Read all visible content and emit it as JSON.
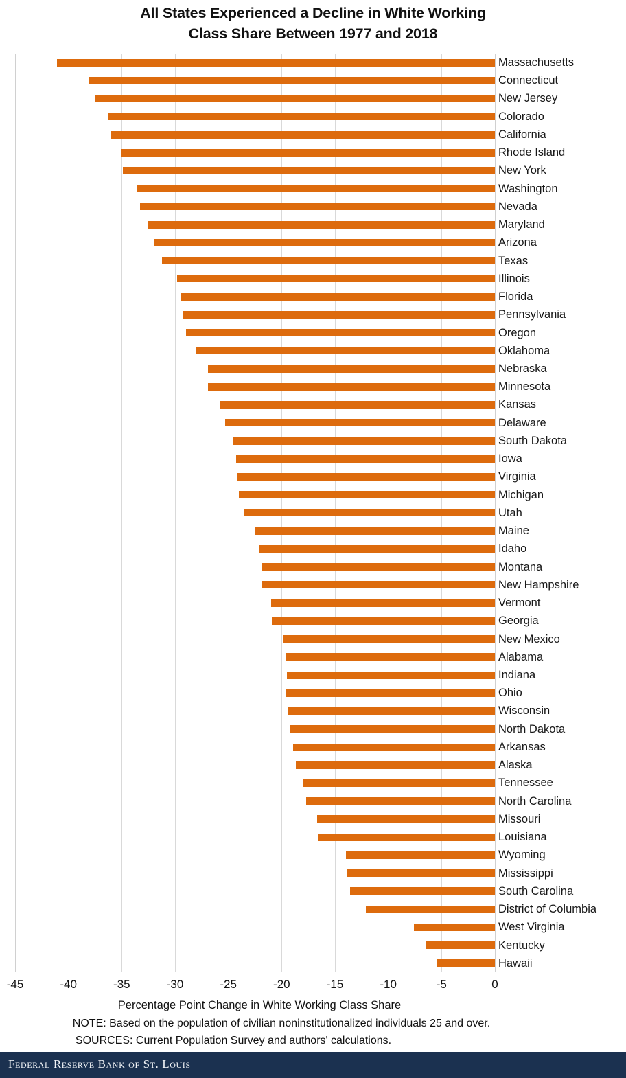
{
  "title": {
    "line1": "All States Experienced a Decline in White Working",
    "line2": "Class Share Between 1977 and 2018"
  },
  "axis_title": "Percentage Point Change in White Working Class Share",
  "note": "NOTE: Based on the population of civilian noninstitutionalized individuals 25 and over.",
  "sources": "SOURCES: Current Population Survey and authors' calculations.",
  "footer": {
    "text": "Federal Reserve Bank of St. Louis",
    "background": "#1B3150"
  },
  "colors": {
    "bar": "#DD6B0D",
    "gridline": "#D9D9D9",
    "text": "#111111"
  },
  "chart_data": {
    "type": "bar",
    "orientation": "horizontal",
    "title": "All States Experienced a Decline in White Working Class Share Between 1977 and 2018",
    "xlabel": "Percentage Point Change in White Working Class Share",
    "ylabel": "",
    "xlim": [
      -45,
      0
    ],
    "xticks": [
      -45,
      -40,
      -35,
      -30,
      -25,
      -20,
      -15,
      -10,
      -5,
      0
    ],
    "grid": true,
    "legend": false,
    "series_color": "#DD6B0D",
    "categories": [
      "Massachusetts",
      "Connecticut",
      "New Jersey",
      "Colorado",
      "California",
      "Rhode Island",
      "New York",
      "Washington",
      "Nevada",
      "Maryland",
      "Arizona",
      "Texas",
      "Illinois",
      "Florida",
      "Pennsylvania",
      "Oregon",
      "Oklahoma",
      "Nebraska",
      "Minnesota",
      "Kansas",
      "Delaware",
      "South Dakota",
      "Iowa",
      "Virginia",
      "Michigan",
      "Utah",
      "Maine",
      "Idaho",
      "Montana",
      "New Hampshire",
      "Vermont",
      "Georgia",
      "New Mexico",
      "Alabama",
      "Indiana",
      "Ohio",
      "Wisconsin",
      "North Dakota",
      "Arkansas",
      "Alaska",
      "Tennessee",
      "North Carolina",
      "Missouri",
      "Louisiana",
      "Wyoming",
      "Mississippi",
      "South Carolina",
      "District of Columbia",
      "West Virginia",
      "Kentucky",
      "Hawaii"
    ],
    "values": [
      -41.1,
      -38.1,
      -37.5,
      -36.3,
      -36.0,
      -35.1,
      -34.9,
      -33.6,
      -33.3,
      -32.5,
      -32.0,
      -31.2,
      -29.8,
      -29.4,
      -29.2,
      -29.0,
      -28.1,
      -26.9,
      -26.9,
      -25.8,
      -25.3,
      -24.6,
      -24.3,
      -24.2,
      -24.0,
      -23.5,
      -22.5,
      -22.1,
      -21.9,
      -21.9,
      -21.0,
      -20.9,
      -19.8,
      -19.6,
      -19.5,
      -19.6,
      -19.4,
      -19.2,
      -18.9,
      -18.7,
      -18.0,
      -17.7,
      -16.7,
      -16.6,
      -14.0,
      -13.9,
      -13.6,
      -12.1,
      -7.6,
      -6.5,
      -5.4
    ]
  }
}
